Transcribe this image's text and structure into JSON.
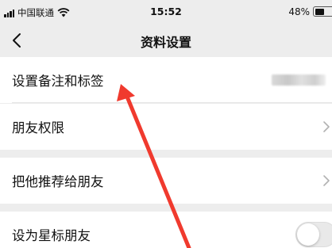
{
  "status_bar": {
    "carrier": "中国联通",
    "time": "15:52",
    "battery": "48%",
    "battery_level": 0.48,
    "icons": [
      "signal-icon",
      "wifi-icon",
      "battery-icon"
    ]
  },
  "nav": {
    "title": "资料设置",
    "back_icon": "chevron-left-icon"
  },
  "rows": {
    "remark": {
      "label": "设置备注和标签",
      "value_blurred": true
    },
    "permissions": {
      "label": "朋友权限"
    },
    "recommend": {
      "label": "把他推荐给朋友"
    },
    "star": {
      "label": "设为星标朋友",
      "toggle_on": false
    }
  },
  "annotation": {
    "type": "red-arrow",
    "color": "#f03a2e",
    "points_to": "设置备注和标签"
  },
  "colors": {
    "background": "#ededed",
    "row_background": "#ffffff",
    "accent_arrow": "#f03a2e"
  }
}
